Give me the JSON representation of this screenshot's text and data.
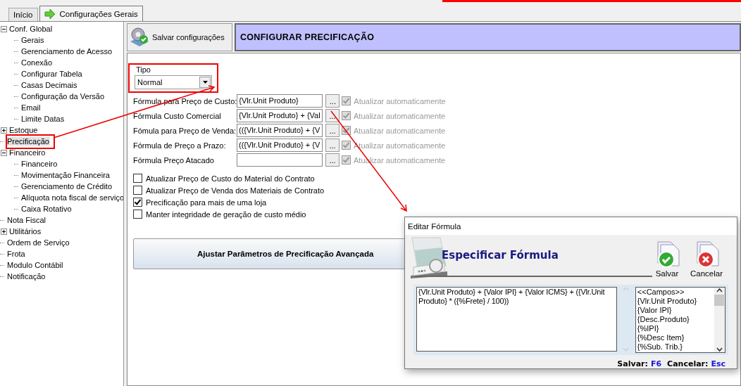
{
  "tabs": [
    {
      "label": "Início",
      "selected": false
    },
    {
      "label": "Configurações Gerais",
      "selected": true
    }
  ],
  "tree": [
    {
      "label": "Conf. Global",
      "expanded": true,
      "selected": false,
      "children": [
        {
          "label": "Gerais",
          "selected": false
        },
        {
          "label": "Gerenciamento de Acesso",
          "selected": false
        },
        {
          "label": "Conexão",
          "selected": false
        },
        {
          "label": "Configurar Tabela",
          "selected": false
        },
        {
          "label": "Casas Decimais",
          "selected": false
        },
        {
          "label": "Configuração da Versão",
          "selected": false
        },
        {
          "label": "Email",
          "selected": false
        },
        {
          "label": "Limite Datas",
          "selected": false
        }
      ]
    },
    {
      "label": "Estoque",
      "expanded": false,
      "selected": false
    },
    {
      "label": "Precificação",
      "selected": true
    },
    {
      "label": "Financeiro",
      "expanded": true,
      "selected": false,
      "children": [
        {
          "label": "Financeiro",
          "selected": false
        },
        {
          "label": "Movimentação Financeira",
          "selected": false
        },
        {
          "label": "Gerenciamento de Crédito",
          "selected": false
        },
        {
          "label": "Alíquota nota fiscal de serviço",
          "selected": false
        },
        {
          "label": "Caixa Rotativo",
          "selected": false
        }
      ]
    },
    {
      "label": "Nota Fiscal",
      "selected": false
    },
    {
      "label": "Utilitários",
      "expanded": false,
      "selected": false
    },
    {
      "label": "Ordem de Serviço",
      "selected": false
    },
    {
      "label": "Frota",
      "selected": false
    },
    {
      "label": "Modulo Contábil",
      "selected": false
    },
    {
      "label": "Notificação",
      "selected": false
    }
  ],
  "toolbar": {
    "save_button": "Salvar configurações",
    "header": "CONFIGURAR PRECIFICAÇÃO"
  },
  "tipo": {
    "label": "Tipo",
    "value": "Normal"
  },
  "formulas": [
    {
      "label": "Fórmula para Preço de Custo:",
      "value": "{Vlr.Unit Produto}",
      "button": "...",
      "auto_label": "Atualizar automaticamente",
      "auto_checked": true,
      "auto_disabled": true
    },
    {
      "label": "Fórmula Custo Comercial",
      "value": "{Vlr.Unit Produto} + {Val",
      "button": "...",
      "auto_label": "Atualizar automaticamente",
      "auto_checked": true,
      "auto_disabled": true
    },
    {
      "label": "Fómula para Preço de Venda:",
      "value": "(({Vlr.Unit Produto} + {V",
      "button": "...",
      "auto_label": "Atualizar automaticamente",
      "auto_checked": true,
      "auto_disabled": true
    },
    {
      "label": "Fórmula de Preço a Prazo:",
      "value": "(({Vlr.Unit Produto} + {V",
      "button": "...",
      "auto_label": "Atualizar automaticamente",
      "auto_checked": true,
      "auto_disabled": true
    },
    {
      "label": "Fórmula Preço Atacado",
      "button": "...",
      "auto_label": "Atualizar automaticamente",
      "auto_checked": true,
      "auto_disabled": true
    }
  ],
  "options": [
    {
      "label": "Atualizar Preço de Custo do Material do Contrato",
      "checked": false
    },
    {
      "label": "Atualizar Preço de Venda dos Materiais de Contrato",
      "checked": false
    },
    {
      "label": "Precificação para mais de uma loja",
      "checked": true
    },
    {
      "label": "Manter integridade de geração de custo médio",
      "checked": false
    }
  ],
  "advanced_button": "Ajustar Parâmetros de Precificação Avançada",
  "dialog": {
    "title": "Editar Fórmula",
    "heading": "Especificar Fórmula",
    "save": "Salvar",
    "cancel": "Cancelar",
    "formula": "{Vlr.Unit Produto} + {Valor IPI} + {Valor ICMS} + ({Vlr.Unit Produto} * ({%Frete} / 100))",
    "fields": [
      "<<Campos>>",
      "{Vlr.Unit Produto}",
      "{Valor IPI}",
      "{Desc.Produto}",
      "{%IPI}",
      "{%Desc Item}",
      "{%Sub. Trib.}"
    ],
    "shortcuts": [
      {
        "label": "Salvar:",
        "key": "F6"
      },
      {
        "label": "Cancelar:",
        "key": "Esc"
      }
    ]
  }
}
